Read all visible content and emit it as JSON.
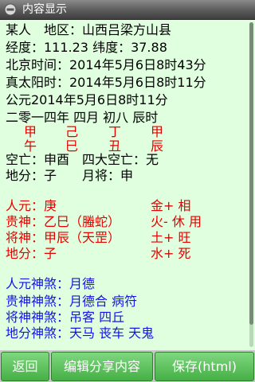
{
  "titlebar": {
    "title": "内容显示",
    "icon": "app-icon"
  },
  "lines": [
    {
      "text": "某人　地区：山西吕梁方山县",
      "color": "black"
    },
    {
      "text": "经度：111.23 纬度：37.88",
      "color": "black"
    },
    {
      "text": "北京时间：2014年5月6日8时43分",
      "color": "black"
    },
    {
      "text": "真太阳时：2014年5月6日8时11分",
      "color": "black"
    },
    {
      "text": "公元2014年5月6日8时11分",
      "color": "black"
    },
    {
      "text": "二零一四年 四月 初八 辰时",
      "color": "black"
    }
  ],
  "pillars": {
    "stems": [
      "甲",
      "己",
      "丁",
      "甲"
    ],
    "branches": [
      "午",
      "巳",
      "丑",
      "辰"
    ]
  },
  "void_line": "空亡：申酉　四大空亡：无",
  "earth_line": "地分：子　　月将：申",
  "positions": [
    {
      "left": "人元：庚",
      "right": "金+ 相"
    },
    {
      "left": "贵神：乙巳（螣蛇）",
      "right": "火- 休 用"
    },
    {
      "left": "将神：甲辰（天罡）",
      "right": "土+ 旺"
    },
    {
      "left": "地分：子",
      "right": "水+ 死"
    }
  ],
  "shensha": [
    "人元神煞：月德",
    "贵神神煞：月德合 病符",
    "将神神煞：吊客 四丘",
    "地分神煞：天马 丧车 天鬼"
  ],
  "buttons": {
    "back": "返回",
    "edit_share": "编辑分享内容",
    "save": "保存(html)"
  },
  "colors": {
    "background": "#dfffdf",
    "red": "#e60000",
    "blue": "#1414e6",
    "button": "#45b045"
  }
}
